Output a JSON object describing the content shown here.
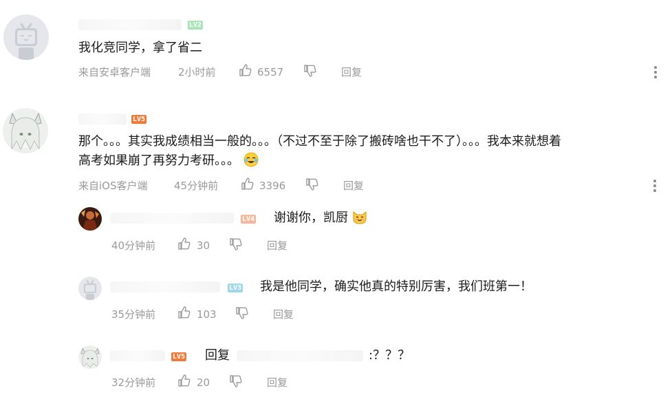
{
  "comments": [
    {
      "level": "LV2",
      "text": "我化竞同学，拿了省二",
      "source": "来自安卓客户端",
      "time": "2小时前",
      "likes": "6557",
      "reply_label": "回复"
    },
    {
      "level": "LV5",
      "text_line1": "那个。。。其实我成绩相当一般的。。。（不过不至于除了搬砖啥也干不了）。。。我本来就想着",
      "text_line2": "高考如果崩了再努力考研。。。",
      "source": "来自iOS客户端",
      "time": "45分钟前",
      "likes": "3396",
      "reply_label": "回复",
      "replies": [
        {
          "level": "LV4",
          "text": "谢谢你，凯厨",
          "time": "40分钟前",
          "likes": "30",
          "reply_label": "回复"
        },
        {
          "level": "LV3",
          "text": "我是他同学，确实他真的特别厉害，我们班第一！",
          "time": "35分钟前",
          "likes": "103",
          "reply_label": "回复"
        },
        {
          "level": "LV5",
          "reply_prefix": "回复",
          "text": ":？？？",
          "time": "32分钟前",
          "likes": "20",
          "reply_label": "回复"
        }
      ]
    }
  ],
  "colors": {
    "lv2": "#a8e6b8",
    "lv3": "#9fd8e8",
    "lv4": "#f5b89a",
    "lv5": "#f07a3a",
    "meta": "#9a9a9a"
  },
  "icons": {
    "like": "thumbs-up-icon",
    "dislike": "thumbs-down-icon",
    "more": "vertical-dots-icon"
  }
}
